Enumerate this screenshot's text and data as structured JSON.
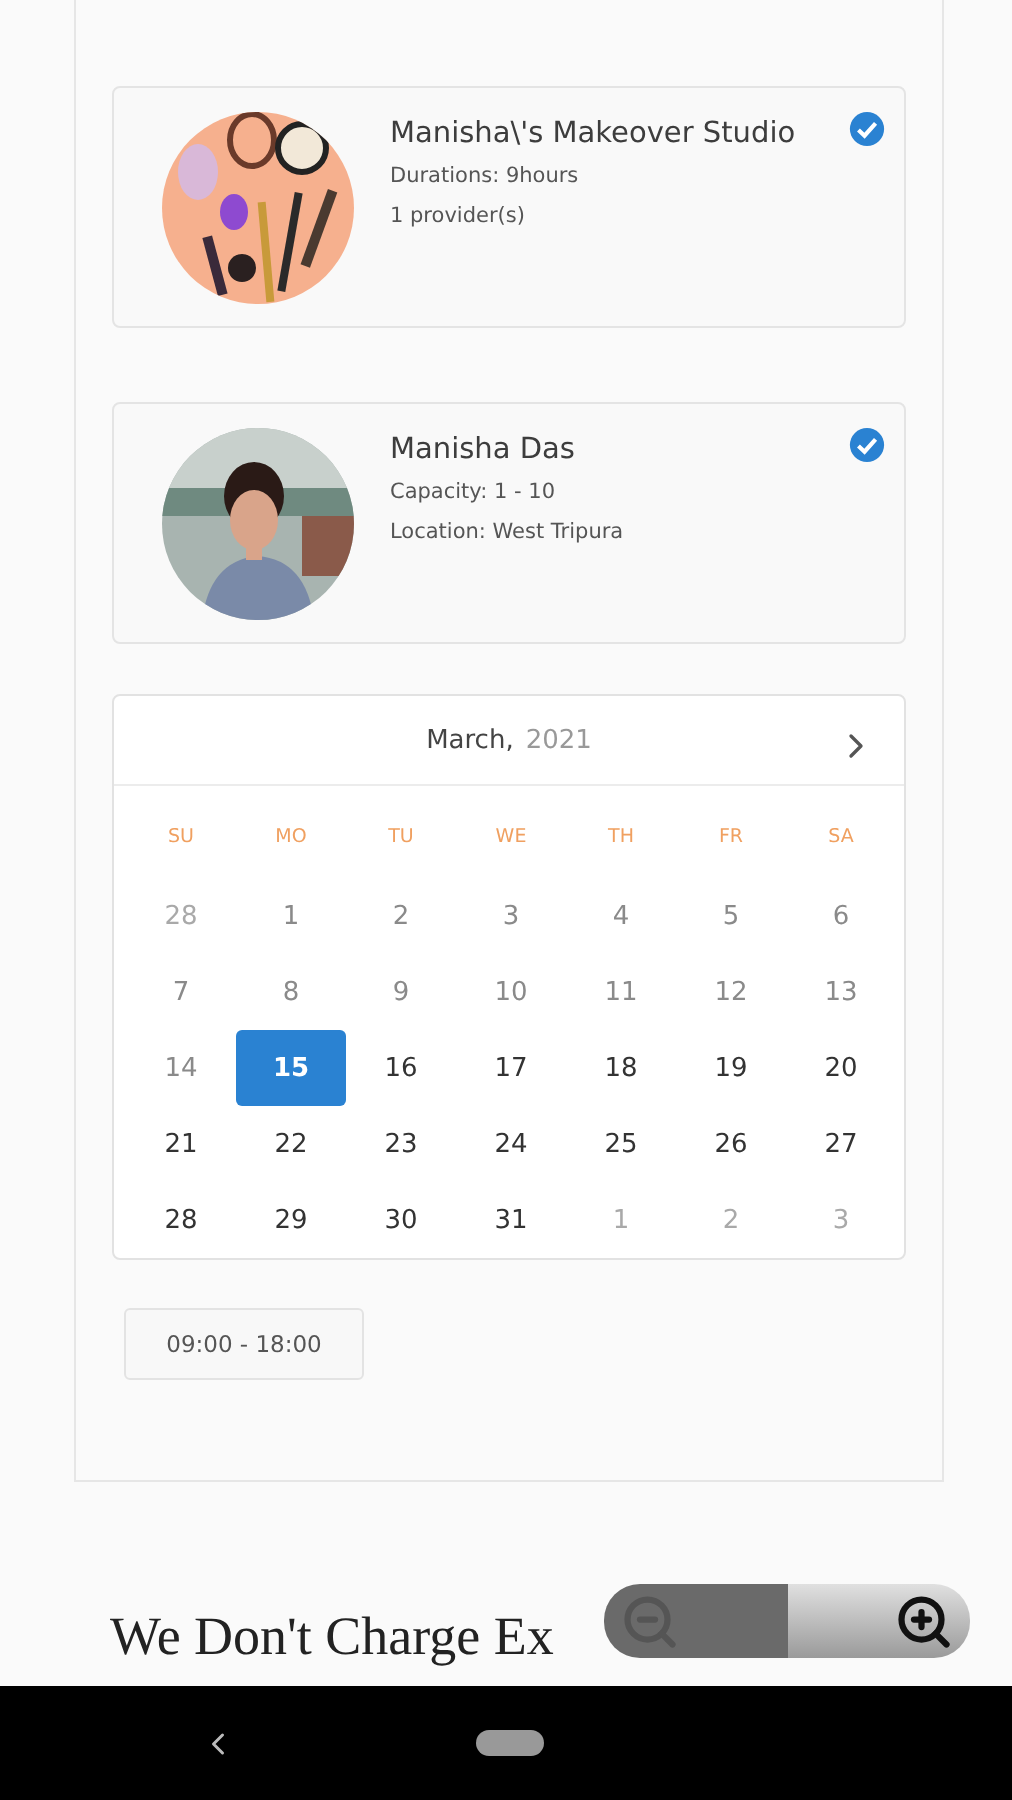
{
  "cards": [
    {
      "title": "Manisha\\'s Makeover Studio",
      "lines": [
        "Durations: 9hours",
        "1 provider(s)"
      ],
      "checked": true
    },
    {
      "title": "Manisha Das",
      "lines": [
        "Capacity: 1 - 10",
        "Location: West Tripura"
      ],
      "checked": true
    }
  ],
  "calendar": {
    "month": "March,",
    "year": "2021",
    "weekdays": [
      "SU",
      "MO",
      "TU",
      "WE",
      "TH",
      "FR",
      "SA"
    ],
    "weeks": [
      [
        {
          "day": "28",
          "kind": "outside",
          "selected": false
        },
        {
          "day": "1",
          "kind": "past",
          "selected": false
        },
        {
          "day": "2",
          "kind": "past",
          "selected": false
        },
        {
          "day": "3",
          "kind": "past",
          "selected": false
        },
        {
          "day": "4",
          "kind": "past",
          "selected": false
        },
        {
          "day": "5",
          "kind": "past",
          "selected": false
        },
        {
          "day": "6",
          "kind": "past",
          "selected": false
        }
      ],
      [
        {
          "day": "7",
          "kind": "past",
          "selected": false
        },
        {
          "day": "8",
          "kind": "past",
          "selected": false
        },
        {
          "day": "9",
          "kind": "past",
          "selected": false
        },
        {
          "day": "10",
          "kind": "past",
          "selected": false
        },
        {
          "day": "11",
          "kind": "past",
          "selected": false
        },
        {
          "day": "12",
          "kind": "past",
          "selected": false
        },
        {
          "day": "13",
          "kind": "past",
          "selected": false
        }
      ],
      [
        {
          "day": "14",
          "kind": "past",
          "selected": false
        },
        {
          "day": "15",
          "kind": "available",
          "selected": true
        },
        {
          "day": "16",
          "kind": "available",
          "selected": false
        },
        {
          "day": "17",
          "kind": "available",
          "selected": false
        },
        {
          "day": "18",
          "kind": "available",
          "selected": false
        },
        {
          "day": "19",
          "kind": "available",
          "selected": false
        },
        {
          "day": "20",
          "kind": "available",
          "selected": false
        }
      ],
      [
        {
          "day": "21",
          "kind": "available",
          "selected": false
        },
        {
          "day": "22",
          "kind": "available",
          "selected": false
        },
        {
          "day": "23",
          "kind": "available",
          "selected": false
        },
        {
          "day": "24",
          "kind": "available",
          "selected": false
        },
        {
          "day": "25",
          "kind": "available",
          "selected": false
        },
        {
          "day": "26",
          "kind": "available",
          "selected": false
        },
        {
          "day": "27",
          "kind": "available",
          "selected": false
        }
      ],
      [
        {
          "day": "28",
          "kind": "available",
          "selected": false
        },
        {
          "day": "29",
          "kind": "available",
          "selected": false
        },
        {
          "day": "30",
          "kind": "available",
          "selected": false
        },
        {
          "day": "31",
          "kind": "available",
          "selected": false
        },
        {
          "day": "1",
          "kind": "outside",
          "selected": false
        },
        {
          "day": "2",
          "kind": "outside",
          "selected": false
        },
        {
          "day": "3",
          "kind": "outside",
          "selected": false
        }
      ]
    ]
  },
  "time_slots": [
    {
      "label": "09:00 - 18:00",
      "selected": false
    }
  ],
  "heading": "We Don't Charge Ex"
}
